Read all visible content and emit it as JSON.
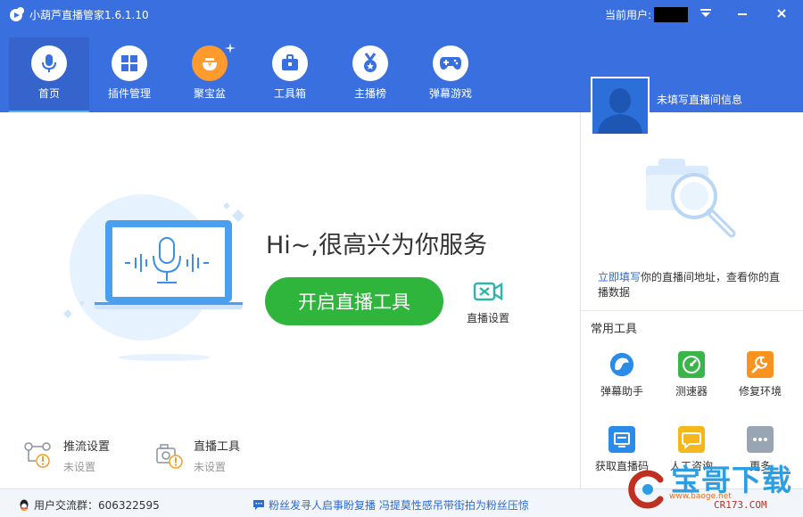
{
  "app": {
    "title": "小葫芦直播管家1.6.1.10",
    "current_user_label": "当前用户:",
    "current_user_value": "",
    "window_buttons": [
      "▼",
      "—",
      "✕"
    ]
  },
  "nav": [
    {
      "label": "首页",
      "icon": "microphone-icon",
      "active": true
    },
    {
      "label": "插件管理",
      "icon": "plugin-blocks-icon",
      "active": false
    },
    {
      "label": "聚宝盆",
      "icon": "treasure-bowl-icon",
      "active": false
    },
    {
      "label": "工具箱",
      "icon": "toolbox-icon",
      "active": false
    },
    {
      "label": "主播榜",
      "icon": "medal-ranking-icon",
      "active": false
    },
    {
      "label": "弹幕游戏",
      "icon": "gamepad-icon",
      "active": false
    }
  ],
  "profile": {
    "room_info_label": "未填写直播间信息"
  },
  "main": {
    "greeting": "Hi~,很高兴为你服务",
    "start_button": "开启直播工具",
    "settings_label": "直播设置",
    "bottom": [
      {
        "title": "推流设置",
        "status": "未设置",
        "icon": "stream-flow-icon"
      },
      {
        "title": "直播工具",
        "status": "未设置",
        "icon": "camera-warning-icon"
      }
    ]
  },
  "right": {
    "link_text": "立即填写",
    "desc_text": "你的直播间地址，查看你的直播数据",
    "tools_title": "常用工具",
    "tools": [
      {
        "label": "弹幕助手",
        "icon": "danmaku-assistant-icon",
        "color": "#2a8ce8"
      },
      {
        "label": "测速器",
        "icon": "speedometer-icon",
        "color": "#3ab54a"
      },
      {
        "label": "修复环境",
        "icon": "wrench-icon",
        "color": "#f7931e"
      },
      {
        "label": "获取直播码",
        "icon": "stream-code-icon",
        "color": "#2a8ce8"
      },
      {
        "label": "人工咨询",
        "icon": "chat-bubble-icon",
        "color": "#f5b81c"
      },
      {
        "label": "更多",
        "icon": "more-dots-icon",
        "color": "#9aa5b4"
      }
    ]
  },
  "status_bar": {
    "group_label": "用户交流群：606322595",
    "news": "粉丝发寻人启事盼复播 冯提莫性感吊带街拍为粉丝压惊"
  },
  "watermark": {
    "main": "宝哥下载",
    "site": "www.baoge.net",
    "brand": "CR173.COM"
  },
  "colors": {
    "header": "#3a6fe0",
    "accent_green": "#2fb53b",
    "link_blue": "#2b6bd6"
  }
}
